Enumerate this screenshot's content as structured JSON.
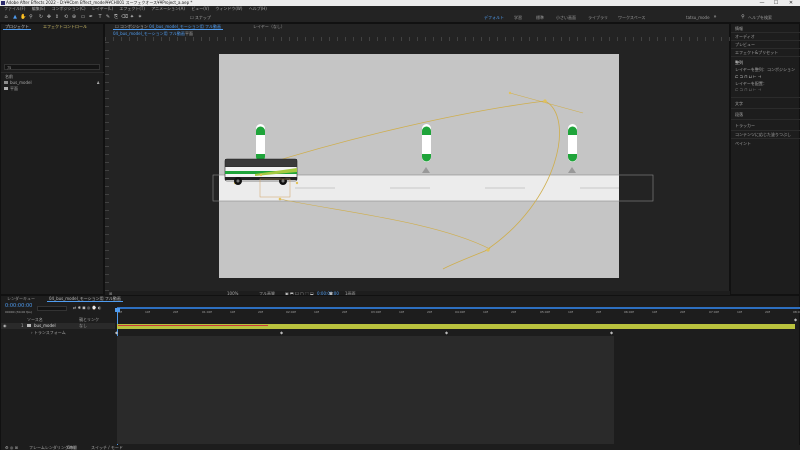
{
  "window": {
    "title": "Adobe After Effects 2022 - D:¥¥Cbm Effect_model¥¥CH001 スーフェクオース¥¥Project_a.aep *",
    "minimize": "—",
    "maximize": "☐",
    "close": "✕"
  },
  "menu": [
    "ファイル(F)",
    "編集(E)",
    "コンポジション(C)",
    "レイヤー(L)",
    "エフェクト(T)",
    "アニメーション(A)",
    "ビュー(V)",
    "ウィンドウ(W)",
    "ヘルプ(H)"
  ],
  "toolbar": {
    "snapping": "スナップ",
    "workspaces": [
      {
        "label": "デフォルト",
        "active": true
      },
      {
        "label": "学習",
        "active": false
      },
      {
        "label": "標準",
        "active": false
      },
      {
        "label": "小さい画面",
        "active": false
      },
      {
        "label": "ライブラリ",
        "active": false
      },
      {
        "label": "ワークスペース",
        "active": false
      },
      {
        "label": "tatsu_mode",
        "active": false
      }
    ],
    "help_search": "ヘルプを検索"
  },
  "project_panel": {
    "tabs": [
      "プロジェクト",
      "エフェクトコントロール"
    ],
    "search_value": "ﾌﾙ",
    "column_name": "名前",
    "items": [
      {
        "name": "bus_model",
        "icon": "comp-icon"
      },
      {
        "name": "平面",
        "icon": "folder-icon"
      }
    ]
  },
  "comp_panel": {
    "tab_label": "コンポジション",
    "tab_comp_name": "04_bus_model_モーション用 フル動画",
    "tab_layer": "レイヤー（なし）",
    "breadcrumb_1": "04_bus_model_モーション用 フル動画",
    "breadcrumb_2": "平面",
    "zoom": "100%",
    "quality": "フル画質",
    "timecode": "0:00:00:00",
    "camera": "アクティブカメラ",
    "view_count": "1画面"
  },
  "right_panel": {
    "items": [
      "情報",
      "オーディオ",
      "プレビュー",
      "エフェクト&プリセット",
      "整列",
      "レイヤーを整列",
      "文字",
      "段落",
      "トラッカー",
      "コンテンツに応じた塗りつぶし",
      "ペイント"
    ],
    "align_to_label": "レイヤーを整列：",
    "align_to_value": "コンポジション",
    "distribute_label": "レイヤーを配置："
  },
  "timeline": {
    "tabs": [
      "レンダーキュー",
      "04_bus_model_モーション用 フル動画"
    ],
    "timecode": "0:00:00:00",
    "frame_info": "00000 (30.00 fps)",
    "search_placeholder": "",
    "column_source": "ソース名",
    "column_parent": "親とリンク",
    "layer_number": "1",
    "layer_name": "bus_model",
    "layer_parent": "なし",
    "sub_prop": "トランスフォーム",
    "ruler_labels": [
      "00f",
      "10f",
      "20f",
      "01:00f",
      "10f",
      "20f",
      "02:00f",
      "10f",
      "20f",
      "03:00f",
      "10f",
      "20f",
      "04:00f",
      "10f",
      "20f",
      "05:00f",
      "10f",
      "20f",
      "06:00f",
      "10f",
      "20f",
      "07:00f",
      "10f",
      "20f",
      "08:00f"
    ],
    "footer_left": "フレームレンダリング時間",
    "footer_ms": "0ms",
    "footer_toggle": "スイッチ / モード"
  },
  "colors": {
    "accent": "#4f9cf0",
    "comp_bg": "#c5c5c5",
    "road": "#ececec",
    "pole_green": "#1fa43a",
    "motion_path": "#cfae4c",
    "layer_bar": "#b9c23e",
    "work_area": "#2d6fc0"
  }
}
